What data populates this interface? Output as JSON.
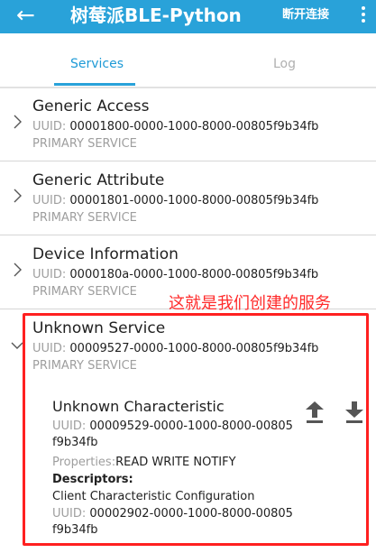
{
  "appbar": {
    "back_icon": "arrow-left-icon",
    "title": "树莓派BLE-Python",
    "action_label": "断开连接",
    "more_icon": "more-vertical-icon"
  },
  "tabs": [
    {
      "label": "Services",
      "active": true
    },
    {
      "label": "Log",
      "active": false
    }
  ],
  "colors": {
    "accent": "#29a2d9",
    "highlight": "#ff2020"
  },
  "uuid_label": "UUID:",
  "services": [
    {
      "name": "Generic Access",
      "uuid": "00001800-0000-1000-8000-00805f9b34fb",
      "type": "PRIMARY SERVICE",
      "expanded": false
    },
    {
      "name": "Generic Attribute",
      "uuid": "00001801-0000-1000-8000-00805f9b34fb",
      "type": "PRIMARY SERVICE",
      "expanded": false
    },
    {
      "name": "Device Information",
      "uuid": "0000180a-0000-1000-8000-00805f9b34fb",
      "type": "PRIMARY SERVICE",
      "expanded": false
    },
    {
      "name": "Unknown Service",
      "uuid": "00009527-0000-1000-8000-00805f9b34fb",
      "type": "PRIMARY SERVICE",
      "expanded": true
    }
  ],
  "annotation": "这就是我们创建的服务",
  "characteristic": {
    "name": "Unknown Characteristic",
    "uuid": "00009529-0000-1000-8000-00805f9b34fb",
    "properties_label": "Properties:",
    "properties_value": "READ WRITE NOTIFY",
    "descriptors_heading": "Descriptors:",
    "descriptor_name": "Client Characteristic Configuration",
    "descriptor_uuid": "00002902-0000-1000-8000-00805f9b34fb",
    "write_icon": "upload-icon",
    "read_icon": "download-icon"
  }
}
